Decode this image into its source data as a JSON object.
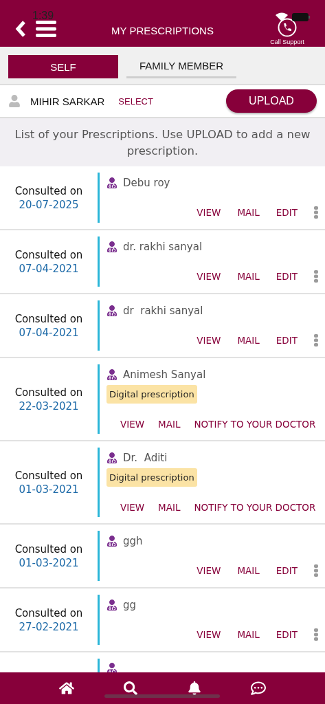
{
  "status_bar": {
    "time": "1:39"
  },
  "header": {
    "title": "MY PRESCRIPTIONS",
    "support_label": "Call Support"
  },
  "tabs": [
    {
      "label": "SELF",
      "selected": true
    },
    {
      "label": "FAMILY MEMBER",
      "selected": false
    }
  ],
  "patient": {
    "name": "MIHIR SARKAR",
    "select_label": "SELECT",
    "upload_label": "UPLOAD"
  },
  "info": "List of your Prescriptions. Use UPLOAD to add a new prescription.",
  "prescriptions": [
    {
      "kind": "standard",
      "consulted_label": "Consulted on",
      "date": "20-07-2025",
      "doctor": "Debu roy",
      "actions": [
        "VIEW",
        "MAIL",
        "EDIT"
      ]
    },
    {
      "kind": "standard",
      "consulted_label": "Consulted on",
      "date": "07-04-2021",
      "doctor": "dr. rakhi sanyal",
      "actions": [
        "VIEW",
        "MAIL",
        "EDIT"
      ]
    },
    {
      "kind": "standard",
      "consulted_label": "Consulted on",
      "date": "07-04-2021",
      "doctor": "dr  rakhi sanyal",
      "actions": [
        "VIEW",
        "MAIL",
        "EDIT"
      ]
    },
    {
      "kind": "digital",
      "consulted_label": "Consulted on",
      "date": "22-03-2021",
      "doctor": "Animesh Sanyal",
      "badge": "Digital prescription",
      "actions": [
        "VIEW",
        "MAIL",
        "NOTIFY TO YOUR DOCTOR"
      ]
    },
    {
      "kind": "digital",
      "consulted_label": "Consulted on",
      "date": "01-03-2021",
      "doctor": "Dr.  Aditi",
      "badge": "Digital prescription",
      "actions": [
        "VIEW",
        "MAIL",
        "NOTIFY TO YOUR DOCTOR"
      ]
    },
    {
      "kind": "standard",
      "consulted_label": "Consulted on",
      "date": "01-03-2021",
      "doctor": "ggh",
      "actions": [
        "VIEW",
        "MAIL",
        "EDIT"
      ]
    },
    {
      "kind": "standard",
      "consulted_label": "Consulted on",
      "date": "27-02-2021",
      "doctor": "gg",
      "actions": [
        "VIEW",
        "MAIL",
        "EDIT"
      ]
    },
    {
      "kind": "partial"
    }
  ]
}
